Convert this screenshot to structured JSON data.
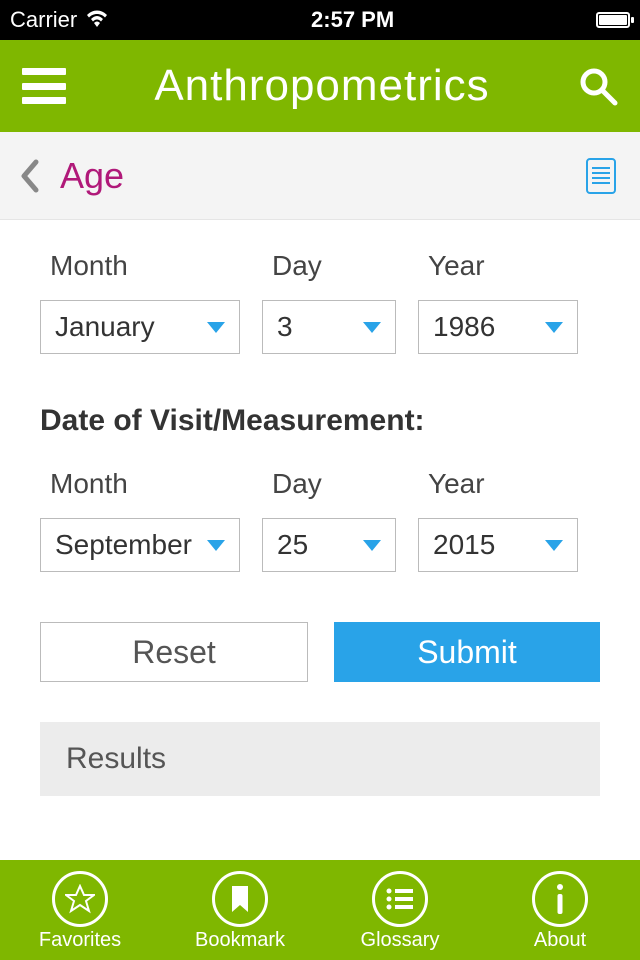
{
  "status": {
    "carrier": "Carrier",
    "time": "2:57 PM"
  },
  "header": {
    "title": "Anthropometrics"
  },
  "subheader": {
    "page_title": "Age"
  },
  "birthdate": {
    "month_label": "Month",
    "month_value": "January",
    "day_label": "Day",
    "day_value": "3",
    "year_label": "Year",
    "year_value": "1986"
  },
  "visit_heading": "Date of Visit/Measurement:",
  "visitdate": {
    "month_label": "Month",
    "month_value": "September",
    "day_label": "Day",
    "day_value": "25",
    "year_label": "Year",
    "year_value": "2015"
  },
  "buttons": {
    "reset": "Reset",
    "submit": "Submit"
  },
  "results_label": "Results",
  "nav": {
    "favorites": "Favorites",
    "bookmark": "Bookmark",
    "glossary": "Glossary",
    "about": "About"
  }
}
